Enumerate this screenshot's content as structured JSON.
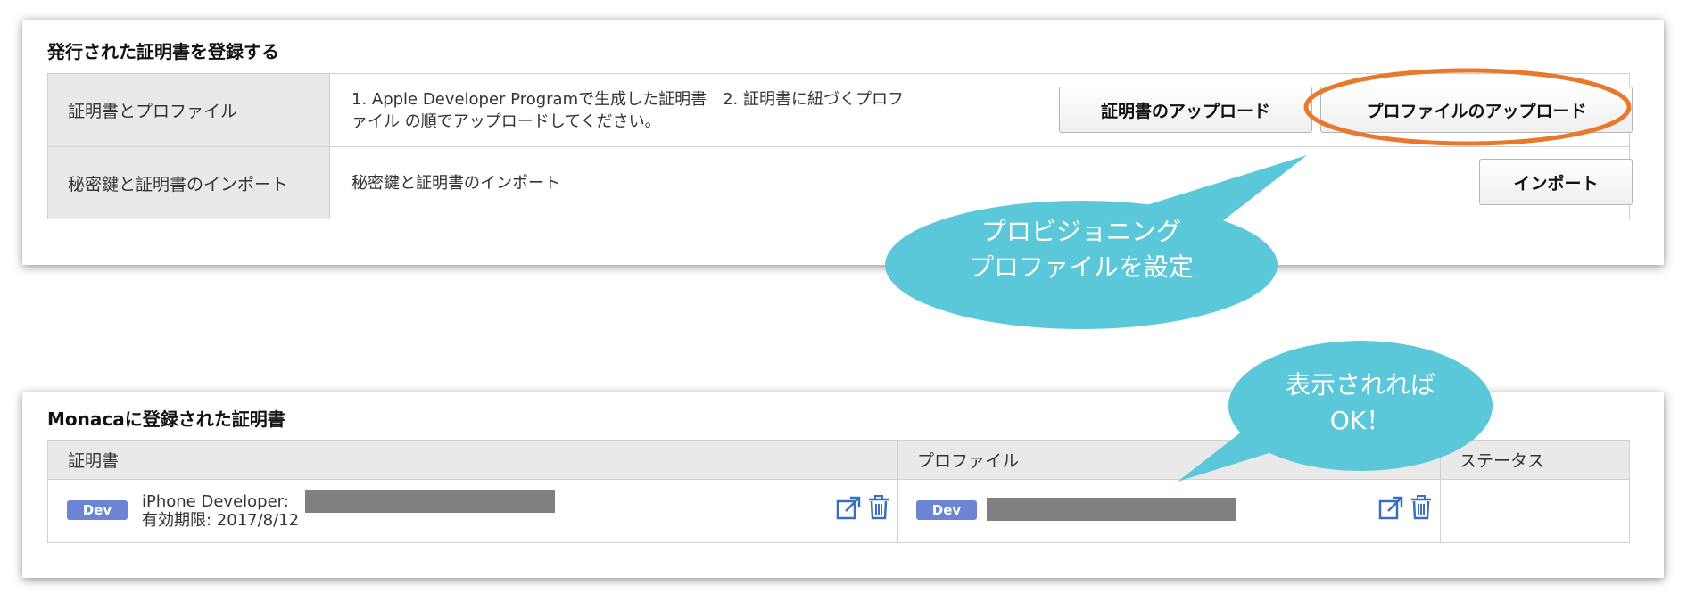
{
  "register_panel": {
    "title": "発行された証明書を登録する",
    "rows": [
      {
        "label": "証明書とプロファイル",
        "description_line1": "1. Apple Developer Programで生成した証明書　2. 証明書に紐づくプロフ",
        "description_line2": "ァイル の順でアップロードしてください。",
        "button_cert": "証明書のアップロード",
        "button_profile": "プロファイルのアップロード"
      },
      {
        "label": "秘密鍵と証明書のインポート",
        "description": "秘密鍵と証明書のインポート",
        "button_import": "インポート"
      }
    ]
  },
  "registered_panel": {
    "title": "Monacaに登録された証明書",
    "columns": [
      "証明書",
      "プロファイル",
      "ステータス"
    ],
    "row": {
      "cert_badge": "Dev",
      "cert_name": "iPhone Developer:",
      "cert_expiry": "有効期限: 2017/8/12",
      "profile_badge": "Dev",
      "status": ""
    }
  },
  "callouts": {
    "profile_callout_line1": "プロビジョニング",
    "profile_callout_line2": "プロファイルを設定",
    "ok_callout_line1": "表示されれば",
    "ok_callout_line2": "OK！"
  },
  "colors": {
    "callout_fill": "#5bc8d9",
    "highlight_ring": "#e8782c",
    "badge": "#6b84d3",
    "icon": "#3a6fbf",
    "redaction": "#808080"
  },
  "icons": [
    "external-link-icon",
    "trash-icon"
  ]
}
